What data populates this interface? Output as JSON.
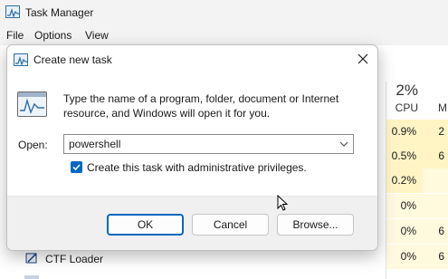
{
  "task_manager": {
    "title": "Task Manager",
    "menu": [
      "File",
      "Options",
      "View"
    ],
    "cpu_header": {
      "percent": "2%",
      "label": "CPU"
    },
    "memory_header_partial": "M",
    "cpu_column": [
      "0.9%",
      "0.5%",
      "0.2%",
      "0%",
      "0%",
      "0%"
    ],
    "memory_column_partial": [
      "2",
      "6",
      "",
      "",
      "6",
      "6"
    ],
    "visible_process": "CTF Loader"
  },
  "dialog": {
    "title": "Create new task",
    "description": "Type the name of a program, folder, document or Internet resource, and Windows will open it for you.",
    "open_label": "Open:",
    "open_value": "powershell",
    "admin_checkbox": {
      "label": "Create this task with administrative privileges.",
      "checked": true
    },
    "buttons": {
      "ok": "OK",
      "cancel": "Cancel",
      "browse": "Browse..."
    }
  },
  "colors": {
    "accent": "#0067c0",
    "cpu_heat": "#fff4c4",
    "cpu_heat_light": "#fff9de"
  }
}
